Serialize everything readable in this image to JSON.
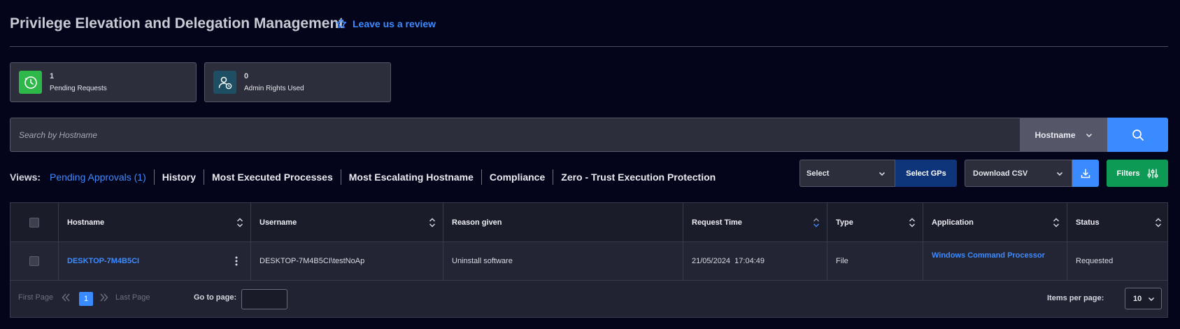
{
  "header": {
    "title": "Privilege Elevation and Delegation Management",
    "review_link": "Leave us a review"
  },
  "stats": [
    {
      "count": "1",
      "label": "Pending Requests",
      "icon": "clock-check-icon",
      "color": "#2fb84a"
    },
    {
      "count": "0",
      "label": "Admin Rights Used",
      "icon": "user-admin-icon",
      "color": "#1d4e63"
    }
  ],
  "search": {
    "placeholder": "Search by Hostname",
    "field": "Hostname"
  },
  "views": {
    "label": "Views:",
    "tabs": [
      {
        "label": "Pending Approvals (1)",
        "active": true
      },
      {
        "label": "History",
        "active": false
      },
      {
        "label": "Most Executed Processes",
        "active": false
      },
      {
        "label": "Most Escalating Hostname",
        "active": false
      },
      {
        "label": "Compliance",
        "active": false
      },
      {
        "label": "Zero - Trust Execution Protection",
        "active": false
      }
    ]
  },
  "toolbar": {
    "select_placeholder": "Select",
    "select_gps": "Select GPs",
    "download_csv": "Download CSV",
    "filters": "Filters"
  },
  "table": {
    "columns": [
      "Hostname",
      "Username",
      "Reason given",
      "Request Time",
      "Type",
      "Application",
      "Status"
    ],
    "rows": [
      {
        "hostname": "DESKTOP-7M4B5CI",
        "username": "DESKTOP-7M4B5CI\\testNoAp",
        "reason": "Uninstall software",
        "request_time": "21/05/2024  17:04:49",
        "type": "File",
        "application": "Windows Command Processor",
        "status": "Requested"
      }
    ]
  },
  "pagination": {
    "first": "First Page",
    "last": "Last Page",
    "current_page": "1",
    "go_to_label": "Go to page:",
    "go_to_value": "",
    "items_per_page_label": "Items per page:",
    "items_per_page": "10"
  },
  "colors": {
    "background": "#04041a",
    "accent": "#3a8bff",
    "filters": "#0d9a54",
    "select_gps": "#0e3579"
  }
}
